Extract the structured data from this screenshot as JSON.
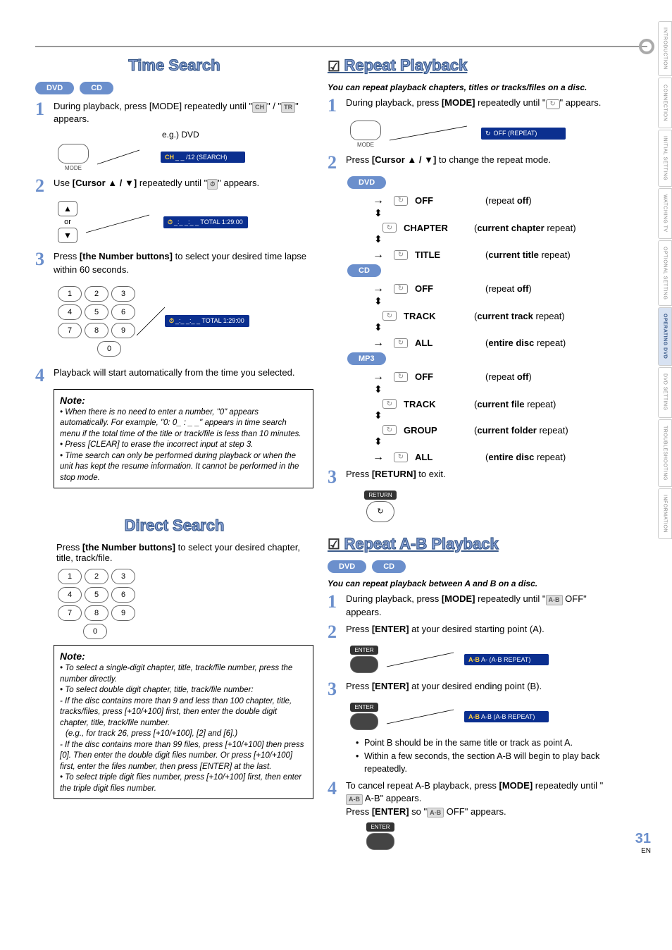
{
  "page": {
    "number": "31",
    "lang": "EN"
  },
  "tabs": [
    "INTRODUCTION",
    "CONNECTION",
    "INITIAL SETTING",
    "WATCHING TV",
    "OPTIONAL SETTING",
    "OPERATING DVD",
    "DVD SETTING",
    "TROUBLESHOOTING",
    "INFORMATION"
  ],
  "time_search": {
    "title": "Time Search",
    "pills": [
      "DVD",
      "CD"
    ],
    "step1": "During playback, press [MODE] repeatedly until \"",
    "step1_ch": "CH",
    "step1_sep": "\" / \"",
    "step1_tr": "TR",
    "step1_end": "\" appears.",
    "eg": "e.g.) DVD",
    "osd1a": "CH",
    "osd1b": "_ _ /12   (SEARCH)",
    "mode_label": "MODE",
    "step2a": "Use ",
    "step2b": "[Cursor ▲ / ▼]",
    "step2c": " repeatedly until \"",
    "step2_icon": "⏱",
    "step2d": "\" appears.",
    "or": "or",
    "osd2": "_:_ _:_ _ TOTAL 1:29:00",
    "step3a": "Press ",
    "step3b": "[the Number buttons]",
    "step3c": " to select your desired time lapse within 60 seconds.",
    "osd3": "_:_ _:_ _ TOTAL 1:29:00",
    "step4": "Playback will start automatically from the time you selected.",
    "note_h": "Note:",
    "note1": "When there is no need to enter a number, \"0\" appears automatically. For example, \"0: 0_ : _ _\" appears in time search menu if the total time of the title or track/file is less than 10 minutes.",
    "note2": "Press [CLEAR] to erase the incorrect input at step 3.",
    "note3": "Time search can only be performed during playback or when the unit has kept the resume information. It cannot be performed in the stop mode."
  },
  "direct_search": {
    "title": "Direct Search",
    "step1a": "Press ",
    "step1b": "[the Number buttons]",
    "step1c": " to select your desired chapter, title, track/file.",
    "note_h": "Note:",
    "note1": "To select a single-digit chapter, title, track/file number, press the number directly.",
    "note2": "To select double digit chapter, title, track/file number:",
    "note2a": "If the disc contains more than 9 and less than 100 chapter, title, tracks/files, press [+10/+100] first, then enter the double digit chapter, title, track/file number.",
    "note2b": "(e.g., for track 26, press [+10/+100], [2] and [6].)",
    "note2c": "If the disc contains more than 99 files, press [+10/+100] then press [0]. Then enter the double digit files number. Or press [+10/+100] first, enter the files number, then press [ENTER] at the last.",
    "note3": "To select triple digit files number, press [+10/+100] first, then enter the triple digit files number."
  },
  "repeat": {
    "title": "Repeat Playback",
    "subtitle": "You can repeat playback chapters, titles or tracks/files on a disc.",
    "step1a": "During playback, press ",
    "step1b": "[MODE]",
    "step1c": " repeatedly until \"",
    "step1d": "\" appears.",
    "osd1": "OFF    (REPEAT)",
    "mode_label": "MODE",
    "step2a": "Press ",
    "step2b": "[Cursor ▲ / ▼]",
    "step2c": " to change the repeat mode.",
    "groups": {
      "dvd": {
        "label": "DVD",
        "rows": [
          [
            "OFF",
            "(repeat off)"
          ],
          [
            "CHAPTER",
            "(current chapter repeat)"
          ],
          [
            "TITLE",
            "(current title repeat)"
          ]
        ]
      },
      "cd": {
        "label": "CD",
        "rows": [
          [
            "OFF",
            "(repeat off)"
          ],
          [
            "TRACK",
            "(current track repeat)"
          ],
          [
            "ALL",
            "(entire disc repeat)"
          ]
        ]
      },
      "mp3": {
        "label": "MP3",
        "rows": [
          [
            "OFF",
            "(repeat off)"
          ],
          [
            "TRACK",
            "(current file repeat)"
          ],
          [
            "GROUP",
            "(current folder repeat)"
          ],
          [
            "ALL",
            "(entire disc repeat)"
          ]
        ]
      }
    },
    "step3a": "Press ",
    "step3b": "[RETURN]",
    "step3c": " to exit.",
    "return_label": "RETURN"
  },
  "repeat_ab": {
    "title": "Repeat A-B Playback",
    "pills": [
      "DVD",
      "CD"
    ],
    "subtitle": "You can repeat playback between A and B on a disc.",
    "step1a": "During playback, press ",
    "step1b": "[MODE]",
    "step1c": " repeatedly until \"",
    "step1_tag": "A-B",
    "step1d": " OFF\" appears.",
    "step2a": "Press ",
    "step2b": "[ENTER]",
    "step2c": " at your desired starting point (A).",
    "osd2": "A-    (A-B REPEAT)",
    "step3a": "Press ",
    "step3b": "[ENTER]",
    "step3c": " at your desired ending point (B).",
    "osd3": "A-B  (A-B REPEAT)",
    "enter_label": "ENTER",
    "bul1": "Point B should be in the same title or track as point A.",
    "bul2": "Within a few seconds, the section A-B will begin to play back repeatedly.",
    "step4a": "To cancel repeat A-B playback, press ",
    "step4b": "[MODE]",
    "step4c": " repeatedly until \"",
    "step4_tag": "A-B",
    "step4d": " A-B\" appears.",
    "step4e": "Press ",
    "step4f": "[ENTER]",
    "step4g": " so \"",
    "step4h": " OFF\" appears."
  }
}
